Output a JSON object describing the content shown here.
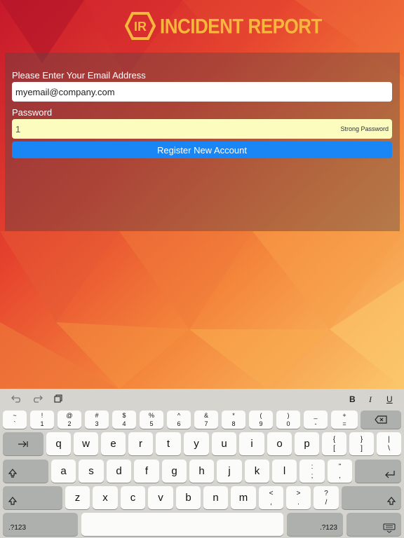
{
  "app": {
    "logo_mark": "IR",
    "title": "INCIDENT REPORT"
  },
  "form": {
    "email_label": "Please Enter Your Email Address",
    "email_value": "myemail@company.com",
    "password_label": "Password",
    "password_value": "1",
    "password_strength": "Strong Password",
    "register_label": "Register New Account"
  },
  "keyboard": {
    "toolbar": {
      "bold": "B",
      "italic": "I",
      "underline": "U"
    },
    "number_row": [
      {
        "top": "~",
        "bottom": "`"
      },
      {
        "top": "!",
        "bottom": "1"
      },
      {
        "top": "@",
        "bottom": "2"
      },
      {
        "top": "#",
        "bottom": "3"
      },
      {
        "top": "$",
        "bottom": "4"
      },
      {
        "top": "%",
        "bottom": "5"
      },
      {
        "top": "^",
        "bottom": "6"
      },
      {
        "top": "&",
        "bottom": "7"
      },
      {
        "top": "*",
        "bottom": "8"
      },
      {
        "top": "(",
        "bottom": "9"
      },
      {
        "top": ")",
        "bottom": "0"
      },
      {
        "top": "_",
        "bottom": "-"
      },
      {
        "top": "+",
        "bottom": "="
      }
    ],
    "row_q": [
      "q",
      "w",
      "e",
      "r",
      "t",
      "y",
      "u",
      "i",
      "o",
      "p"
    ],
    "row_q_symbols": [
      {
        "top": "{",
        "bottom": "["
      },
      {
        "top": "}",
        "bottom": "]"
      },
      {
        "top": "|",
        "bottom": "\\"
      }
    ],
    "row_a": [
      "a",
      "s",
      "d",
      "f",
      "g",
      "h",
      "j",
      "k",
      "l"
    ],
    "row_a_symbols": [
      {
        "top": ":",
        "bottom": ";"
      },
      {
        "top": "”",
        "bottom": ","
      }
    ],
    "row_z": [
      "z",
      "x",
      "c",
      "v",
      "b",
      "n",
      "m"
    ],
    "row_z_symbols": [
      {
        "top": "<",
        "bottom": ","
      },
      {
        "top": ">",
        "bottom": "."
      },
      {
        "top": "?",
        "bottom": "/"
      }
    ],
    "numbers_label_left": ".?123",
    "numbers_label_right": ".?123"
  }
}
